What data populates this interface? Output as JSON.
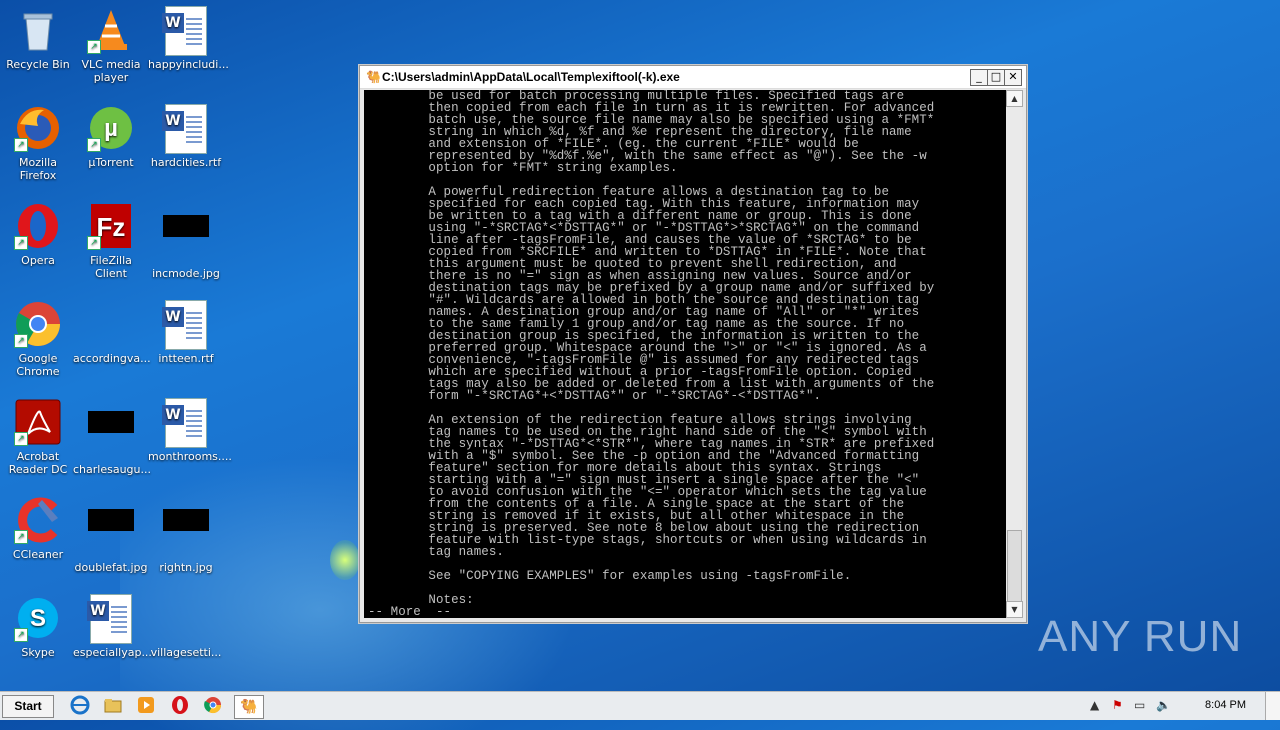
{
  "desktop": {
    "icons": [
      {
        "label": "Recycle Bin",
        "icon": "recycle-bin-icon"
      },
      {
        "label": "VLC media player",
        "icon": "vlc-icon"
      },
      {
        "label": "happyincludi...",
        "icon": "word-doc-icon"
      },
      {
        "label": "Mozilla Firefox",
        "icon": "firefox-icon"
      },
      {
        "label": "µTorrent",
        "icon": "utorrent-icon"
      },
      {
        "label": "hardcities.rtf",
        "icon": "word-doc-icon"
      },
      {
        "label": "Opera",
        "icon": "opera-icon"
      },
      {
        "label": "FileZilla Client",
        "icon": "filezilla-icon"
      },
      {
        "label": "incmode.jpg",
        "icon": "image-icon"
      },
      {
        "label": "Google Chrome",
        "icon": "chrome-icon"
      },
      {
        "label": "accordingva...",
        "icon": "blank-file-icon"
      },
      {
        "label": "intteen.rtf",
        "icon": "word-doc-icon"
      },
      {
        "label": "Acrobat Reader DC",
        "icon": "acrobat-icon"
      },
      {
        "label": "charlesaugu...",
        "icon": "image-icon"
      },
      {
        "label": "monthrooms....",
        "icon": "word-doc-icon"
      },
      {
        "label": "CCleaner",
        "icon": "ccleaner-icon"
      },
      {
        "label": "doublefat.jpg",
        "icon": "image-icon"
      },
      {
        "label": "rightn.jpg",
        "icon": "image-icon"
      },
      {
        "label": "Skype",
        "icon": "skype-icon"
      },
      {
        "label": "especiallyap...",
        "icon": "word-doc-icon"
      },
      {
        "label": "villagesetti...",
        "icon": "blank-file-icon"
      }
    ]
  },
  "window": {
    "title": "C:\\Users\\admin\\AppData\\Local\\Temp\\exiftool(-k).exe",
    "minimize": "_",
    "maximize": "□",
    "close": "✕",
    "console_text": "        be used for batch processing multiple files. Specified tags are\n        then copied from each file in turn as it is rewritten. For advanced\n        batch use, the source file name may also be specified using a *FMT*\n        string in which %d, %f and %e represent the directory, file name\n        and extension of *FILE*. (eg. the current *FILE* would be\n        represented by \"%d%f.%e\", with the same effect as \"@\"). See the -w\n        option for *FMT* string examples.\n\n        A powerful redirection feature allows a destination tag to be\n        specified for each copied tag. With this feature, information may\n        be written to a tag with a different name or group. This is done\n        using \"-*SRCTAG*<*DSTTAG*\" or \"-*DSTTAG*>*SRCTAG*\" on the command\n        line after -tagsFromFile, and causes the value of *SRCTAG* to be\n        copied from *SRCFILE* and written to *DSTTAG* in *FILE*. Note that\n        this argument must be quoted to prevent shell redirection, and\n        there is no \"=\" sign as when assigning new values. Source and/or\n        destination tags may be prefixed by a group name and/or suffixed by\n        \"#\". Wildcards are allowed in both the source and destination tag\n        names. A destination group and/or tag name of \"All\" or \"*\" writes\n        to the same family 1 group and/or tag name as the source. If no\n        destination group is specified, the information is written to the\n        preferred group. Whitespace around the \">\" or \"<\" is ignored. As a\n        convenience, \"-tagsFromFile @\" is assumed for any redirected tags\n        which are specified without a prior -tagsFromFile option. Copied\n        tags may also be added or deleted from a list with arguments of the\n        form \"-*SRCTAG*+<*DSTTAG*\" or \"-*SRCTAG*-<*DSTTAG*\".\n\n        An extension of the redirection feature allows strings involving\n        tag names to be used on the right hand side of the \"<\" symbol with\n        the syntax \"-*DSTTAG*<*STR*\", where tag names in *STR* are prefixed\n        with a \"$\" symbol. See the -p option and the \"Advanced formatting\n        feature\" section for more details about this syntax. Strings\n        starting with a \"=\" sign must insert a single space after the \"<\"\n        to avoid confusion with the \"<=\" operator which sets the tag value\n        from the contents of a file. A single space at the start of the\n        string is removed if it exists, but all other whitespace in the\n        string is preserved. See note 8 below about using the redirection\n        feature with list-type stags, shortcuts or when using wildcards in\n        tag names.\n\n        See \"COPYING EXAMPLES\" for examples using -tagsFromFile.\n\n        Notes:\n-- More  --"
  },
  "watermark": "ANY RUN",
  "taskbar": {
    "start_label": "Start",
    "clock": "8:04 PM"
  }
}
